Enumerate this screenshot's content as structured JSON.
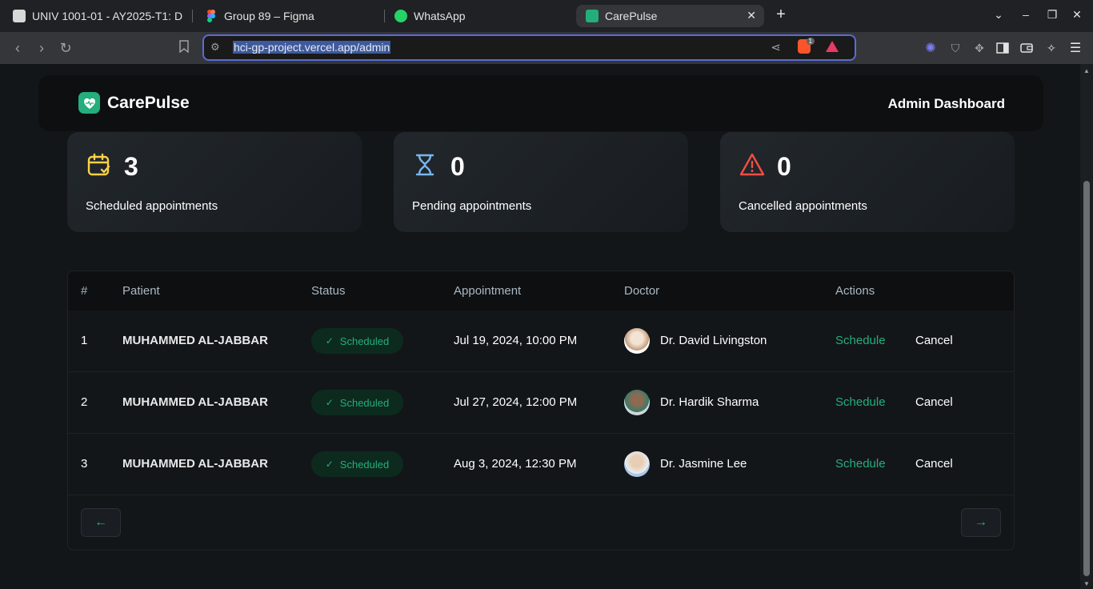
{
  "browser": {
    "tabs": [
      {
        "label": "UNIV 1001-01 - AY2025-T1: D"
      },
      {
        "label": "Group 89 – Figma"
      },
      {
        "label": "WhatsApp"
      },
      {
        "label": "CarePulse"
      }
    ],
    "new_tab": "+",
    "url": "hci-gp-project.vercel.app/admin",
    "brave_badge": "1"
  },
  "header": {
    "logo_text": "CarePulse",
    "title": "Admin Dashboard"
  },
  "stats": [
    {
      "count": "3",
      "label": "Scheduled appointments",
      "color": "#ffd147"
    },
    {
      "count": "0",
      "label": "Pending appointments",
      "color": "#79b5ec"
    },
    {
      "count": "0",
      "label": "Cancelled appointments",
      "color": "#f24e43"
    }
  ],
  "table": {
    "headers": [
      "#",
      "Patient",
      "Status",
      "Appointment",
      "Doctor",
      "Actions"
    ],
    "rows": [
      {
        "num": "1",
        "patient": "MUHAMMED AL-JABBAR",
        "status": "Scheduled",
        "appointment": "Jul 19, 2024, 10:00 PM",
        "doctor": "Dr. David Livingston",
        "schedule": "Schedule",
        "cancel": "Cancel"
      },
      {
        "num": "2",
        "patient": "MUHAMMED AL-JABBAR",
        "status": "Scheduled",
        "appointment": "Jul 27, 2024, 12:00 PM",
        "doctor": "Dr. Hardik Sharma",
        "schedule": "Schedule",
        "cancel": "Cancel"
      },
      {
        "num": "3",
        "patient": "MUHAMMED AL-JABBAR",
        "status": "Scheduled",
        "appointment": "Aug 3, 2024, 12:30 PM",
        "doctor": "Dr. Jasmine Lee",
        "schedule": "Schedule",
        "cancel": "Cancel"
      }
    ]
  },
  "pagination": {
    "prev": "←",
    "next": "→"
  },
  "colors": {
    "accent": "#24ae7c",
    "background": "#131619"
  }
}
